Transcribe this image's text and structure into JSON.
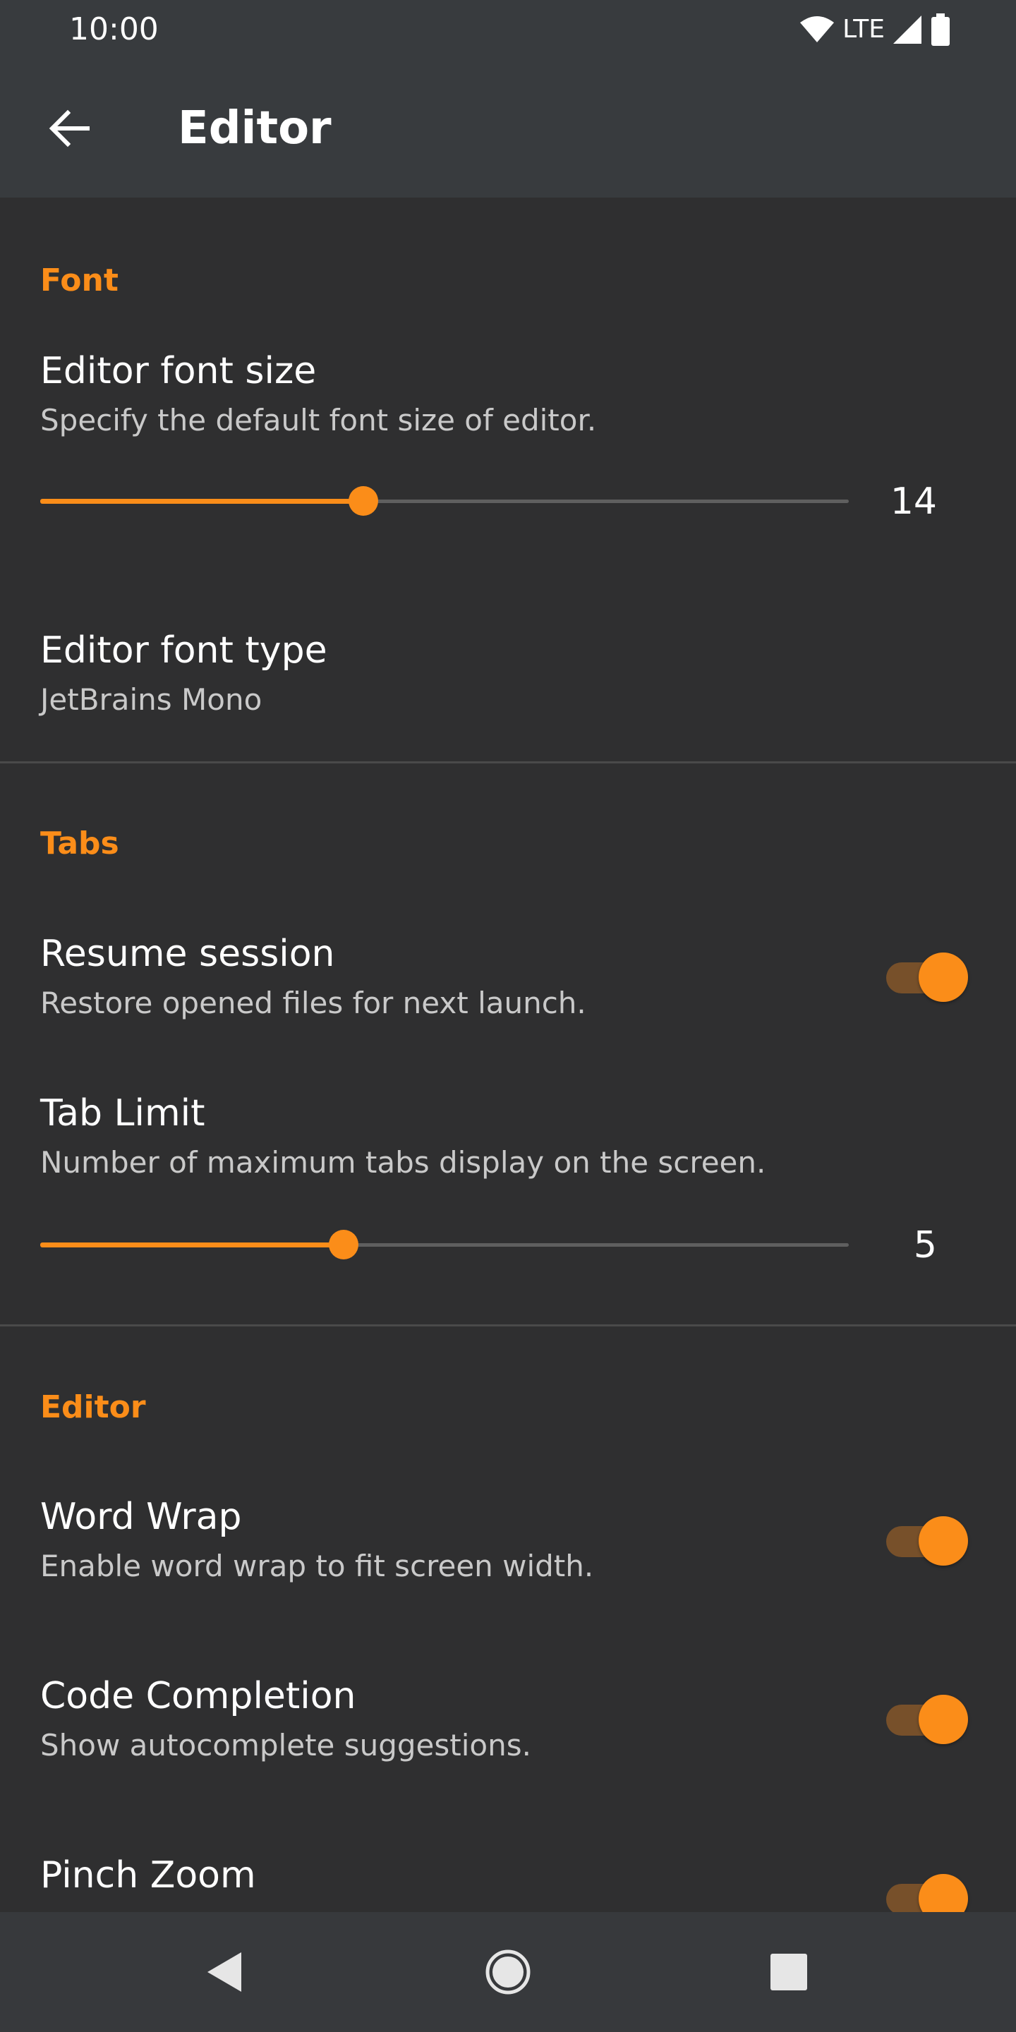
{
  "status_bar": {
    "time": "10:00",
    "network": "LTE",
    "icons": [
      "wifi-icon",
      "cell-signal-icon",
      "battery-icon"
    ]
  },
  "app_bar": {
    "title": "Editor",
    "back_icon": "arrow-left-icon"
  },
  "sections": {
    "font": {
      "header": "Font",
      "font_size": {
        "title": "Editor font size",
        "summary": "Specify the default font size of editor.",
        "value": "14",
        "fraction": 0.4
      },
      "font_type": {
        "title": "Editor font type",
        "summary": "JetBrains Mono"
      }
    },
    "tabs": {
      "header": "Tabs",
      "resume_session": {
        "title": "Resume session",
        "summary": "Restore opened files for next launch.",
        "enabled": true
      },
      "tab_limit": {
        "title": "Tab Limit",
        "summary": "Number of maximum tabs display on the screen.",
        "value": "5",
        "fraction": 0.375
      }
    },
    "editor": {
      "header": "Editor",
      "word_wrap": {
        "title": "Word Wrap",
        "summary": "Enable word wrap to fit screen width.",
        "enabled": true
      },
      "code_completion": {
        "title": "Code Completion",
        "summary": "Show autocomplete suggestions.",
        "enabled": true
      },
      "pinch_zoom": {
        "title": "Pinch Zoom",
        "enabled": true
      }
    }
  },
  "nav_bar": {
    "icons": [
      "back-triangle-icon",
      "home-circle-icon",
      "recents-square-icon"
    ]
  },
  "colors": {
    "accent": "#fb8d19",
    "background": "#2f2f30",
    "toolbar": "#383b3e",
    "switch_track": "#77502a"
  }
}
